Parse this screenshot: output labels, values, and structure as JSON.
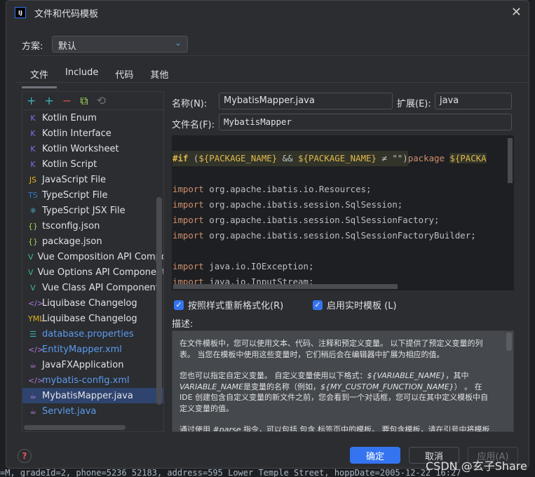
{
  "background_code": "=M, gradeId=2, phone=5236 52183, address=595 Lower Temple Street, hoppDate=2005-12-22 16:27",
  "title": "文件和代码模板",
  "scheme": {
    "label": "方案:",
    "value": "默认"
  },
  "tabs": [
    {
      "label": "文件",
      "active": true
    },
    {
      "label": "Include"
    },
    {
      "label": "代码"
    },
    {
      "label": "其他"
    }
  ],
  "toolbar": {
    "add": "+",
    "add2": "+",
    "remove": "−",
    "copy": "⧉",
    "reset": "⟲"
  },
  "items": [
    {
      "label": "Kotlin Enum",
      "icon": "K",
      "color": "#dfe1e5"
    },
    {
      "label": "Kotlin Interface",
      "icon": "K",
      "color": "#dfe1e5"
    },
    {
      "label": "Kotlin Worksheet",
      "icon": "K",
      "color": "#dfe1e5"
    },
    {
      "label": "Kotlin Script",
      "icon": "K",
      "color": "#dfe1e5"
    },
    {
      "label": "JavaScript File",
      "icon": "JS",
      "color": "#dfe1e5"
    },
    {
      "label": "TypeScript File",
      "icon": "TS",
      "color": "#dfe1e5"
    },
    {
      "label": "TypeScript JSX File",
      "icon": "⚛",
      "color": "#dfe1e5"
    },
    {
      "label": "tsconfig.json",
      "icon": "{}",
      "color": "#dfe1e5"
    },
    {
      "label": "package.json",
      "icon": "{}",
      "color": "#dfe1e5"
    },
    {
      "label": "Vue Composition API Component",
      "icon": "V",
      "color": "#dfe1e5"
    },
    {
      "label": "Vue Options API Component",
      "icon": "V",
      "color": "#dfe1e5"
    },
    {
      "label": "Vue Class API Component",
      "icon": "V",
      "color": "#dfe1e5"
    },
    {
      "label": "Liquibase Changelog",
      "icon": "</>",
      "color": "#dfe1e5"
    },
    {
      "label": "Liquibase Changelog",
      "icon": "YML",
      "color": "#dfe1e5"
    },
    {
      "label": "database.properties",
      "icon": "☰",
      "color": "#5b9bf0"
    },
    {
      "label": "EntityMapper.xml",
      "icon": "</>",
      "color": "#5b9bf0"
    },
    {
      "label": "JavaFXApplication",
      "icon": "☕",
      "color": "#dfe1e5"
    },
    {
      "label": "mybatis-config.xml",
      "icon": "</>",
      "color": "#5b9bf0"
    },
    {
      "label": "MybatisMapper.java",
      "icon": "☕",
      "color": "#dfe1e5",
      "selected": true
    },
    {
      "label": "Servlet.java",
      "icon": "☕",
      "color": "#5b9bf0"
    }
  ],
  "form": {
    "name_label": "名称(N):",
    "name_value": "MybatisMapper.java",
    "ext_label": "扩展(E):",
    "ext_value": "java",
    "filename_label": "文件名(F):",
    "filename_value": "MybatisMapper"
  },
  "code": {
    "line1": {
      "if": "#if",
      "open": " (",
      "var1": "${PACKAGE_NAME}",
      "and": " && ",
      "var2": "${PACKAGE_NAME}",
      "neq": " ≠ \"\")",
      "pkg": "package ",
      "var3": "${PACKA"
    },
    "imports": [
      "org.apache.ibatis.io.Resources;",
      "org.apache.ibatis.session.SqlSession;",
      "org.apache.ibatis.session.SqlSessionFactory;",
      "org.apache.ibatis.session.SqlSessionFactoryBuilder;",
      "",
      "java.io.IOException;",
      "java.io.InputStream;"
    ],
    "import_kw": "import"
  },
  "checkboxes": [
    {
      "label": "按照样式重新格式化(R)",
      "checked": true
    },
    {
      "label": "启用实时模板 (L)",
      "checked": true
    }
  ],
  "desc_label": "描述:",
  "description": {
    "p1": "在文件模板中，您可以使用文本、代码、注释和预定义变量。 以下提供了预定义变量的列表。 当您在模板中使用这些变量时，它们稍后会在编辑器中扩展为相应的值。",
    "p2a": "您也可以指定自定义变量。 自定义变量使用以下格式：",
    "p2v1": "${VARIABLE_NAME}",
    "p2b": "，其中 ",
    "p2v2": "VARIABLE_NAME",
    "p2c": "是变量的名称（例如，",
    "p2v3": "${MY_CUSTOM_FUNCTION_NAME}",
    "p2d": "） 。 在 IDE 创建包含自定义变量的新文件之前，您会看到一个对话框，您可以在其中定义模板中自定义变量的值。",
    "p3a": "通过使用 ",
    "p3v": "#parse",
    "p3b": " 指令，可以包括 包含 标签页中的模板。 要包含模板，请在引号中将模板"
  },
  "buttons": {
    "ok": "确定",
    "cancel": "取消",
    "apply": "应用(A)"
  },
  "watermark": "CSDN @玄子Share"
}
